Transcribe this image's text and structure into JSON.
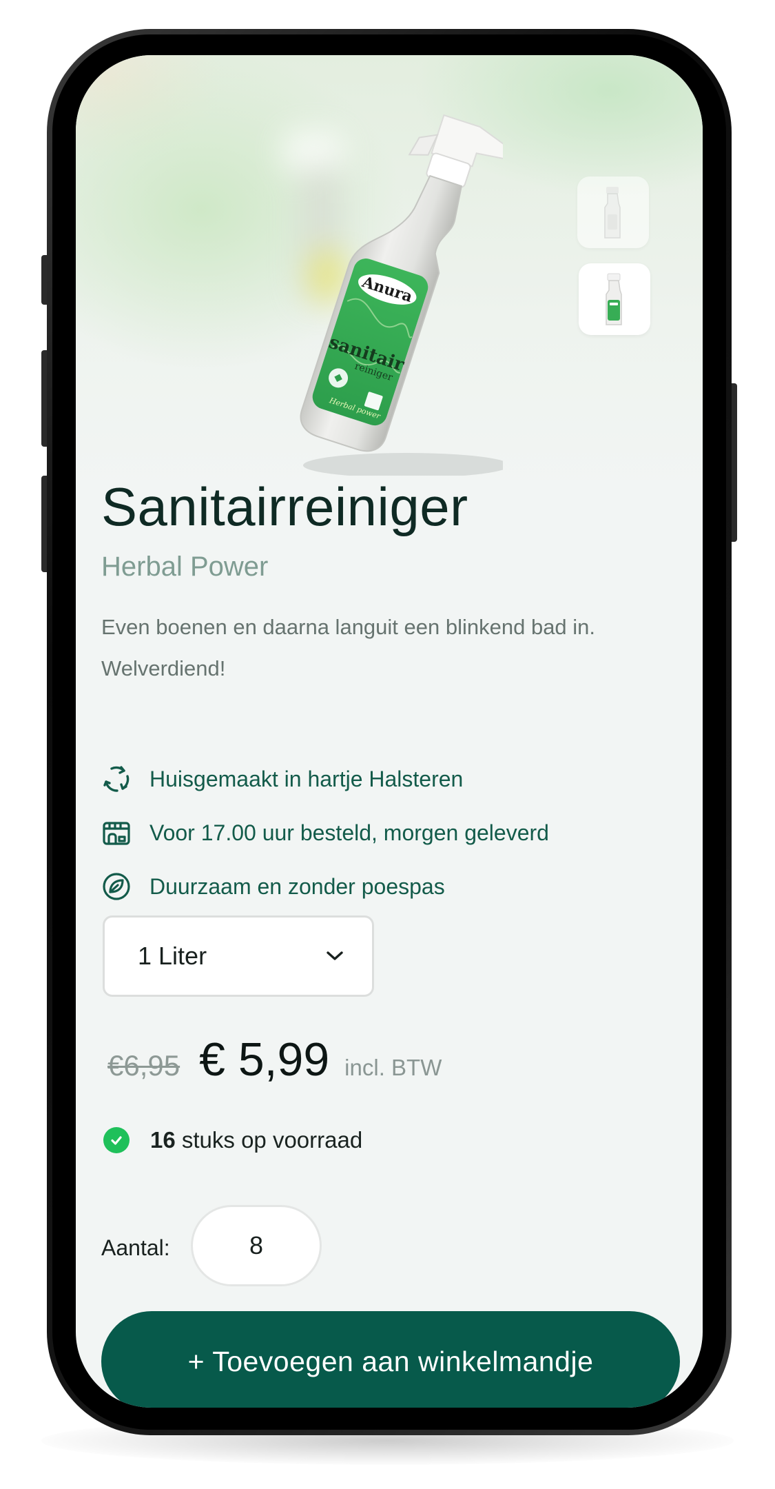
{
  "product": {
    "title": "Sanitairreiniger",
    "subtitle": "Herbal Power",
    "description": "Even boenen en daarna languit een blinkend bad in. Welverdiend!",
    "label_brand": "Anura",
    "label_name": "sanitair",
    "label_sub": "reiniger",
    "label_variant": "Herbal power"
  },
  "features": [
    {
      "icon": "recycle-icon",
      "text": "Huisgemaakt in hartje Halsteren"
    },
    {
      "icon": "delivery-store-icon",
      "text": "Voor 17.00 uur besteld, morgen geleverd"
    },
    {
      "icon": "leaf-circle-icon",
      "text": "Duurzaam en zonder poespas"
    }
  ],
  "variant_select": {
    "value": "1 Liter",
    "icon": "chevron-down-icon"
  },
  "price": {
    "old": "€6,95",
    "current": "€ 5,99",
    "vat_note": "incl. BTW"
  },
  "stock": {
    "count": "16",
    "text": " stuks op voorraad",
    "icon": "check-circle-icon"
  },
  "quantity": {
    "label": "Aantal:",
    "value": "8"
  },
  "cta": {
    "label": "+ Toevoegen aan winkelmandje"
  },
  "colors": {
    "accent": "#075a4b",
    "feature_text": "#135b4a",
    "stock_ok": "#1fc05a",
    "subtitle": "#7f9c92"
  }
}
